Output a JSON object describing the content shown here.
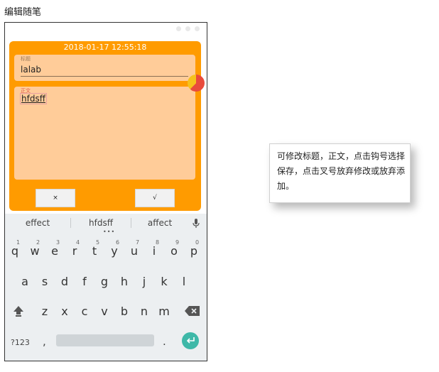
{
  "page_title": "编辑随笔",
  "editor": {
    "date": "2018-01-17 12:55:18",
    "title_hint": "标题",
    "title_value": "lalab",
    "body_hint": "正文",
    "body_value": "hfdsff",
    "cancel_label": "×",
    "confirm_label": "√",
    "colors": {
      "card": "#ff9b00",
      "field": "#ffcc99",
      "enter": "#3eb8a8"
    }
  },
  "keyboard": {
    "suggestions": [
      "effect",
      "hfdsff",
      "affect"
    ],
    "row1": [
      {
        "key": "q",
        "num": "1"
      },
      {
        "key": "w",
        "num": "2"
      },
      {
        "key": "e",
        "num": "3"
      },
      {
        "key": "r",
        "num": "4"
      },
      {
        "key": "t",
        "num": "5"
      },
      {
        "key": "y",
        "num": "6"
      },
      {
        "key": "u",
        "num": "7"
      },
      {
        "key": "i",
        "num": "8"
      },
      {
        "key": "o",
        "num": "9"
      },
      {
        "key": "p",
        "num": "0"
      }
    ],
    "row2": [
      "a",
      "s",
      "d",
      "f",
      "g",
      "h",
      "j",
      "k",
      "l"
    ],
    "row3": [
      "z",
      "x",
      "c",
      "v",
      "b",
      "n",
      "m"
    ],
    "symbols_label": "?123",
    "comma": ",",
    "period": "."
  },
  "note": {
    "text": "可修改标题，正文，点击钩号选择保存，点击叉号放弃修改或放弃添加。"
  }
}
